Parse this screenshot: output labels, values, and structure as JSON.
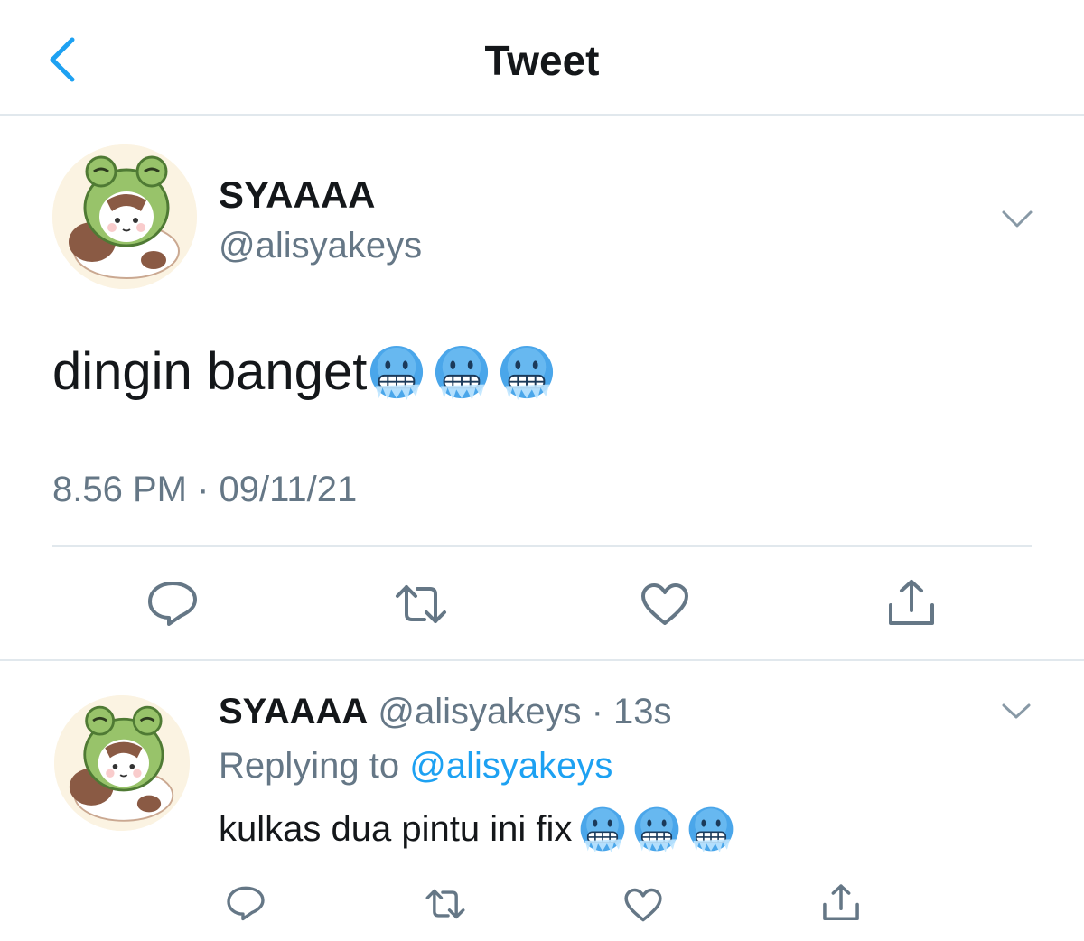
{
  "nav": {
    "title": "Tweet",
    "back_icon": "chevron-left-icon"
  },
  "colors": {
    "accent": "#1da1f2",
    "secondary_text": "#657786",
    "primary_text": "#14171a",
    "divider": "#e1e8ed"
  },
  "tweet": {
    "display_name": "SYAAAA",
    "handle": "@alisyakeys",
    "text": "dingin banget",
    "emoji": [
      "cold-face-emoji",
      "cold-face-emoji",
      "cold-face-emoji"
    ],
    "timestamp": "8.56 PM · 09/11/21",
    "actions": [
      "reply-icon",
      "retweet-icon",
      "like-icon",
      "share-icon"
    ]
  },
  "reply": {
    "display_name": "SYAAAA",
    "meta": "@alisyakeys · 13s",
    "replying_prefix": "Replying to ",
    "replying_handle": "@alisyakeys",
    "text": "kulkas dua pintu ini fix",
    "emoji": [
      "cold-face-emoji",
      "cold-face-emoji",
      "cold-face-emoji"
    ],
    "actions": [
      "reply-icon",
      "retweet-icon",
      "like-icon",
      "share-icon"
    ]
  }
}
